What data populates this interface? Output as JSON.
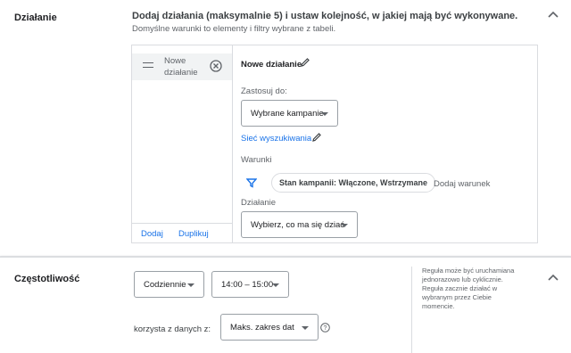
{
  "action_section": {
    "title": "Działanie",
    "headline": "Dodaj działania (maksymalnie 5) i ustaw kolejność, w jakiej mają być wykonywane.",
    "subline": "Domyślne warunki to elementy i filtry wybrane z tabeli.",
    "list": {
      "items": [
        {
          "label": "Nowe działanie"
        }
      ],
      "add_label": "Dodaj",
      "duplicate_label": "Duplikuj"
    },
    "detail": {
      "name": "Nowe działanie",
      "apply_label": "Zastosuj do:",
      "apply_value": "Wybrane kampanie",
      "network_link": "Sieć wyszukiwania",
      "conditions_label": "Warunki",
      "condition_chip": "Stan kampanii: Włączone, Wstrzymane",
      "add_condition": "Dodaj warunek",
      "action_label": "Działanie",
      "action_placeholder": "Wybierz, co ma się dziać"
    }
  },
  "frequency_section": {
    "title": "Częstotliwość",
    "frequency_value": "Codziennie",
    "time_value": "14:00 – 15:00",
    "data_label": "korzysta z danych z:",
    "data_range_value": "Maks. zakres dat",
    "help_text": "Reguła może być uruchamiana jednorazowo lub cyklicznie. Reguła zacznie działać w wybranym przez Ciebie momencie."
  },
  "colors": {
    "link": "#1a73e8",
    "filter_icon": "#1a73e8",
    "text": "#202124",
    "muted": "#5f6368",
    "border": "#dadce0"
  }
}
